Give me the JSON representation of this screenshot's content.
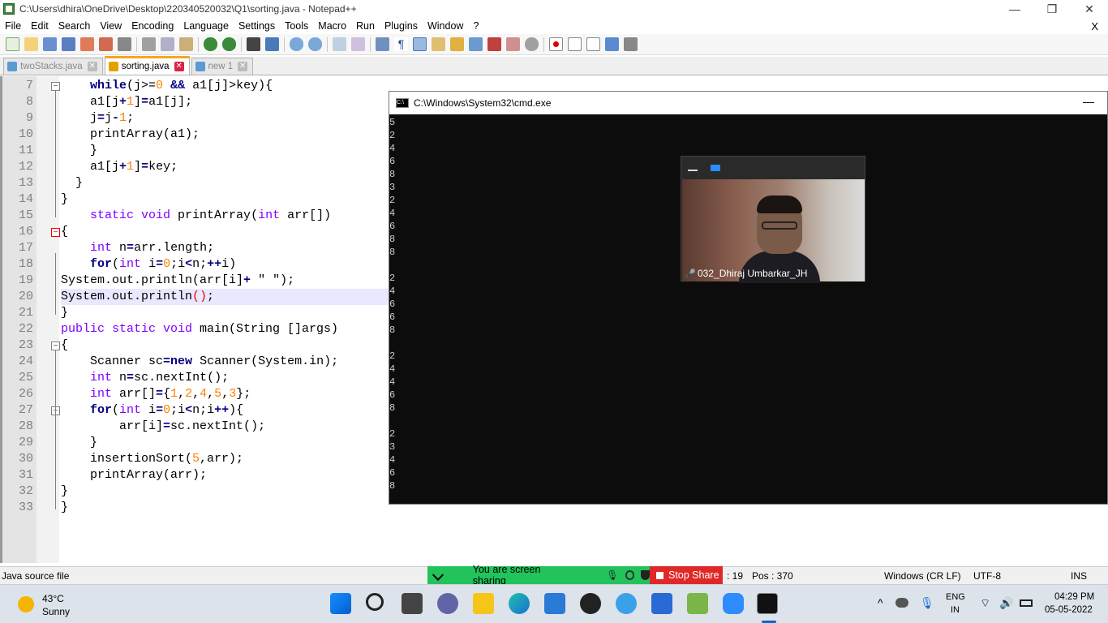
{
  "window": {
    "title": "C:\\Users\\dhira\\OneDrive\\Desktop\\220340520032\\Q1\\sorting.java - Notepad++",
    "minimize": "—",
    "restore": "❐",
    "close": "✕"
  },
  "menu": [
    "File",
    "Edit",
    "Search",
    "View",
    "Encoding",
    "Language",
    "Settings",
    "Tools",
    "Macro",
    "Run",
    "Plugins",
    "Window",
    "?"
  ],
  "menu_close": "X",
  "tabs": [
    {
      "label": "twoStacks.java",
      "active": false
    },
    {
      "label": "sorting.java",
      "active": true
    },
    {
      "label": "new 1",
      "active": false
    }
  ],
  "editor": {
    "lines": [
      {
        "n": "7",
        "html": "    <span class=\"kw\">while</span>(j&gt;=<span class=\"nm\">0</span> <span class=\"op\">&amp;&amp;</span> a1[j]&gt;key){"
      },
      {
        "n": "8",
        "html": "    a1[j<span class=\"op\">+</span><span class=\"nm\">1</span>]<span class=\"op\">=</span>a1[j];"
      },
      {
        "n": "9",
        "html": "    j<span class=\"op\">=</span>j<span class=\"op\">-</span><span class=\"nm\">1</span>;"
      },
      {
        "n": "10",
        "html": "    printArray(a1);"
      },
      {
        "n": "11",
        "html": "    }"
      },
      {
        "n": "12",
        "html": "    a1[j<span class=\"op\">+</span><span class=\"nm\">1</span>]<span class=\"op\">=</span>key;"
      },
      {
        "n": "13",
        "html": "  }"
      },
      {
        "n": "14",
        "html": "}"
      },
      {
        "n": "15",
        "html": "    <span class=\"ty\">static void</span> printArray(<span class=\"ty\">int</span> arr[])"
      },
      {
        "n": "16",
        "html": "{"
      },
      {
        "n": "17",
        "html": "    <span class=\"ty\">int</span> n<span class=\"op\">=</span>arr.length;"
      },
      {
        "n": "18",
        "html": "    <span class=\"kw\">for</span>(<span class=\"ty\">int</span> i<span class=\"op\">=</span><span class=\"nm\">0</span>;i<span class=\"op\">&lt;</span>n;<span class=\"op\">++</span>i)"
      },
      {
        "n": "19",
        "html": "System.out.println(arr[i]<span class=\"op\">+</span> \" \");"
      },
      {
        "n": "20",
        "html": "System.out.println<span style=\"color:#e00\">()</span>;"
      },
      {
        "n": "21",
        "html": "}"
      },
      {
        "n": "22",
        "html": "<span class=\"ty\">public static void</span> main(String []args)"
      },
      {
        "n": "23",
        "html": "{"
      },
      {
        "n": "24",
        "html": "    Scanner sc<span class=\"op\">=</span><span class=\"kw\">new</span> Scanner(System.in);"
      },
      {
        "n": "25",
        "html": "    <span class=\"ty\">int</span> n<span class=\"op\">=</span>sc.nextInt();"
      },
      {
        "n": "26",
        "html": "    <span class=\"ty\">int</span> arr[]<span class=\"op\">=</span>{<span class=\"nm\">1</span>,<span class=\"nm\">2</span>,<span class=\"nm\">4</span>,<span class=\"nm\">5</span>,<span class=\"nm\">3</span>};"
      },
      {
        "n": "27",
        "html": "    <span class=\"kw\">for</span>(<span class=\"ty\">int</span> i<span class=\"op\">=</span><span class=\"nm\">0</span>;i<span class=\"op\">&lt;</span>n;i<span class=\"op\">++</span>){"
      },
      {
        "n": "28",
        "html": "        arr[i]<span class=\"op\">=</span>sc.nextInt();"
      },
      {
        "n": "29",
        "html": "    }"
      },
      {
        "n": "30",
        "html": "    insertionSort(<span class=\"nm\">5</span>,arr);"
      },
      {
        "n": "31",
        "html": "    printArray(arr);"
      },
      {
        "n": "32",
        "html": "}"
      },
      {
        "n": "33",
        "html": "}"
      }
    ]
  },
  "cmd": {
    "title": "C:\\Windows\\System32\\cmd.exe",
    "output": [
      "5",
      "2",
      "4",
      "6",
      "8",
      "3",
      "2",
      "4",
      "6",
      "8",
      "8",
      "",
      "2",
      "4",
      "6",
      "6",
      "8",
      "",
      "2",
      "4",
      "4",
      "6",
      "8",
      "",
      "2",
      "3",
      "4",
      "6",
      "8"
    ]
  },
  "video": {
    "name": "032_Dhiraj Umbarkar_JH"
  },
  "status": {
    "filetype": "Java source file",
    "share_text": "You are screen sharing",
    "stop_share": "Stop Share",
    "ln": ": 19",
    "pos": "Pos : 370",
    "eol": "Windows (CR LF)",
    "encoding": "UTF-8",
    "mode": "INS"
  },
  "taskbar": {
    "temp": "43°C",
    "weather": "Sunny",
    "lang1": "ENG",
    "lang2": "IN",
    "time": "04:29 PM",
    "date": "05-05-2022"
  }
}
